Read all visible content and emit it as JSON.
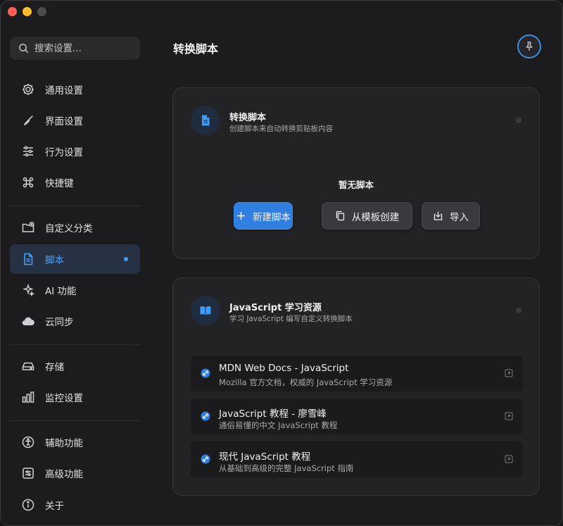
{
  "colors": {
    "accent": "#2f7fe0",
    "accent_text": "#4aa3ff",
    "active_bg": "#263244"
  },
  "sidebar": {
    "search_placeholder": "搜索设置...",
    "items": [
      {
        "label": "通用设置",
        "icon": "gear-icon"
      },
      {
        "label": "界面设置",
        "icon": "brush-icon"
      },
      {
        "label": "行为设置",
        "icon": "sliders-icon"
      },
      {
        "label": "快捷键",
        "icon": "command-icon"
      },
      {
        "label": "自定义分类",
        "icon": "folder-add-icon"
      },
      {
        "label": "脚本",
        "icon": "document-icon",
        "active": true
      },
      {
        "label": "AI 功能",
        "icon": "sparkles-icon"
      },
      {
        "label": "云同步",
        "icon": "cloud-icon"
      },
      {
        "label": "存储",
        "icon": "drive-icon"
      },
      {
        "label": "监控设置",
        "icon": "bars-icon"
      },
      {
        "label": "辅助功能",
        "icon": "accessibility-icon"
      },
      {
        "label": "高级功能",
        "icon": "advanced-icon"
      },
      {
        "label": "关于",
        "icon": "info-icon"
      }
    ]
  },
  "main": {
    "title": "转换脚本",
    "pin_icon": "pin-icon",
    "scripts_card": {
      "title": "转换脚本",
      "subtitle": "创建脚本来自动转换剪贴板内容",
      "empty_label": "暂无脚本",
      "new_button": "新建脚本",
      "template_button": "从模板创建",
      "import_button": "导入"
    },
    "resources_card": {
      "title": "JavaScript 学习资源",
      "subtitle": "学习 JavaScript 编写自定义转换脚本",
      "links": [
        {
          "title": "MDN Web Docs - JavaScript",
          "subtitle": "Mozilla 官方文档，权威的 JavaScript 学习资源"
        },
        {
          "title": "JavaScript 教程 - 廖雪峰",
          "subtitle": "通俗易懂的中文 JavaScript 教程"
        },
        {
          "title": "现代 JavaScript 教程",
          "subtitle": "从基础到高级的完整 JavaScript 指南"
        }
      ]
    }
  }
}
